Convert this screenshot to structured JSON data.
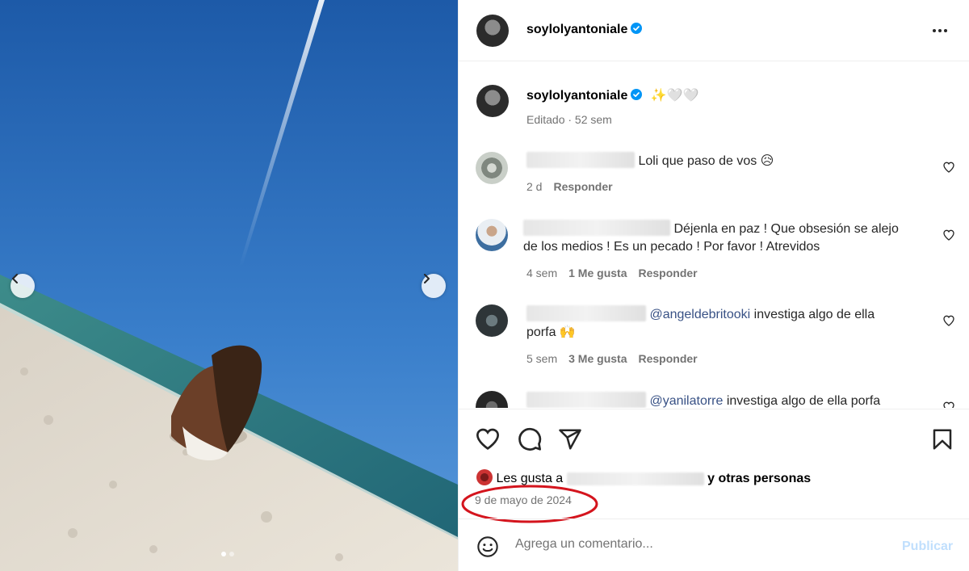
{
  "post": {
    "author": "soylolyantoniale",
    "caption_emoji": "✨🤍🤍",
    "caption_meta": "Editado · 52 sem"
  },
  "comments": [
    {
      "text": "Loli que paso de vos 😥",
      "time": "2 d",
      "likes": "",
      "reply": "Responder"
    },
    {
      "text_line1": "Déjenla en paz ! Que obsesión se alejo",
      "text_line2": "de los medios ! Es un pecado ! Por favor ! Atrevidos",
      "time": "4 sem",
      "likes": "1 Me gusta",
      "reply": "Responder"
    },
    {
      "mention": "@angeldebritooki",
      "text_line1": " investiga algo de ella",
      "text_line2": "porfa 🙌",
      "time": "5 sem",
      "likes": "3 Me gusta",
      "reply": "Responder"
    },
    {
      "mention": "@yanilatorre",
      "text_line1": " investiga algo de ella porfa"
    }
  ],
  "likes": {
    "prefix": "Les gusta a",
    "suffix": "y otras personas"
  },
  "date": "9 de mayo de 2024",
  "composer": {
    "placeholder": "Agrega un comentario...",
    "publish": "Publicar"
  },
  "colors": {
    "verified": "#0095f6",
    "annotation": "#d4141d",
    "mention": "#385185"
  },
  "icons": [
    "chevron-left-icon",
    "chevron-right-icon",
    "verified-icon",
    "more-icon",
    "heart-icon",
    "comment-icon",
    "share-icon",
    "bookmark-icon",
    "emoji-icon"
  ]
}
